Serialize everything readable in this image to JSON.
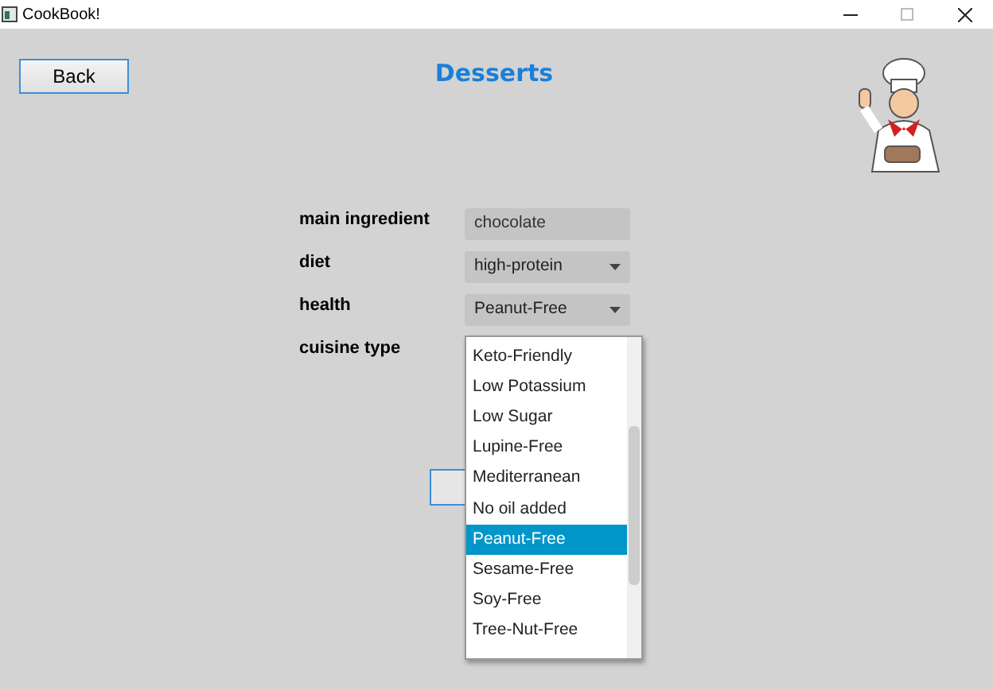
{
  "window": {
    "title": "CookBook!"
  },
  "back_button": "Back",
  "heading": "Desserts",
  "form": {
    "fields": [
      {
        "label": "main ingredient",
        "kind": "text",
        "value": "chocolate"
      },
      {
        "label": "diet",
        "kind": "select",
        "value": "high-protein"
      },
      {
        "label": "health",
        "kind": "select",
        "value": "Peanut-Free"
      },
      {
        "label": "cuisine type",
        "kind": "none"
      }
    ]
  },
  "health_dropdown": {
    "options": [
      {
        "label": "Keto-Friendly",
        "selected": false
      },
      {
        "label": "Low Potassium",
        "selected": false
      },
      {
        "label": "Low Sugar",
        "selected": false
      },
      {
        "label": "Lupine-Free",
        "selected": false
      },
      {
        "label": "Mediterranean",
        "selected": false
      },
      {
        "label": "No oil added",
        "selected": false
      },
      {
        "label": "Peanut-Free",
        "selected": true
      },
      {
        "label": "Sesame-Free",
        "selected": false
      },
      {
        "label": "Soy-Free",
        "selected": false
      },
      {
        "label": "Tree-Nut-Free",
        "selected": false
      }
    ]
  }
}
